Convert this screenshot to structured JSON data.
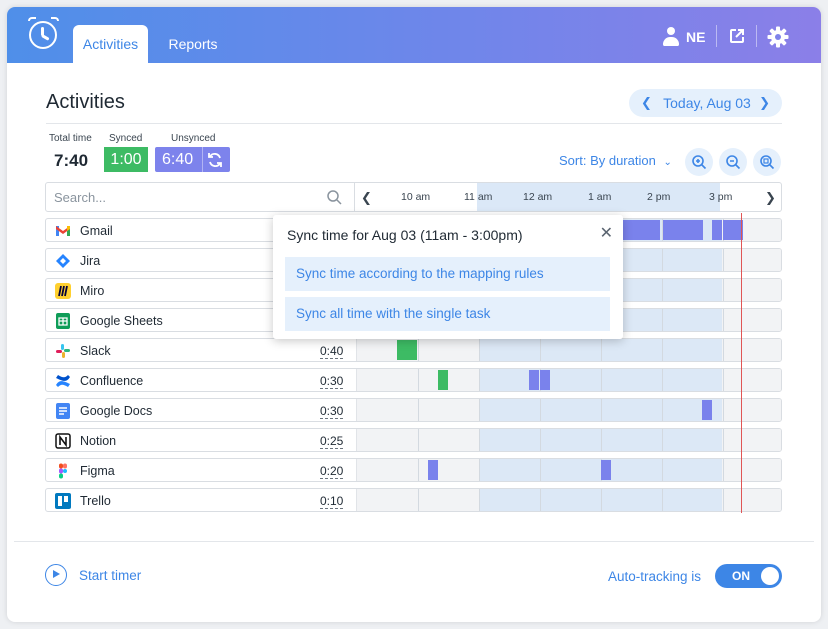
{
  "header": {
    "tabs": [
      {
        "label": "Activities",
        "active": true
      },
      {
        "label": "Reports",
        "active": false
      }
    ],
    "user_initials": "NE"
  },
  "page": {
    "title": "Activities",
    "date_label": "Today,  Aug 03"
  },
  "stats": {
    "total_label": "Total time",
    "total_value": "7:40",
    "synced_label": "Synced",
    "synced_value": "1:00",
    "unsynced_label": "Unsynced",
    "unsynced_value": "6:40"
  },
  "sort": {
    "label": "Sort: By duration"
  },
  "search": {
    "placeholder": "Search..."
  },
  "timeline": {
    "hours": [
      "10 am",
      "11 am",
      "12 am",
      "1 am",
      "2 pm",
      "3 pm"
    ]
  },
  "activities": [
    {
      "name": "Gmail",
      "duration": "",
      "icon": "gmail-icon"
    },
    {
      "name": "Jira",
      "duration": "",
      "icon": "jira-icon"
    },
    {
      "name": "Miro",
      "duration": "",
      "icon": "miro-icon"
    },
    {
      "name": "Google Sheets",
      "duration": "",
      "icon": "google-sheets-icon"
    },
    {
      "name": "Slack",
      "duration": "0:40",
      "icon": "slack-icon"
    },
    {
      "name": "Confluence",
      "duration": "0:30",
      "icon": "confluence-icon"
    },
    {
      "name": "Google Docs",
      "duration": "0:30",
      "icon": "google-docs-icon"
    },
    {
      "name": "Notion",
      "duration": "0:25",
      "icon": "notion-icon"
    },
    {
      "name": "Figma",
      "duration": "0:20",
      "icon": "figma-icon"
    },
    {
      "name": "Trello",
      "duration": "0:10",
      "icon": "trello-icon"
    }
  ],
  "popup": {
    "title_prefix": "Sync time for Aug 03",
    "title_range": "(11am - 3:00pm)",
    "option_mapping": "Sync time according to the mapping rules",
    "option_single": "Sync all time with the single task"
  },
  "footer": {
    "start_timer": "Start timer",
    "auto_tracking_label": "Auto-tracking is",
    "auto_tracking_state": "ON"
  },
  "colors": {
    "accent": "#3d86e6",
    "synced": "#3dbb64",
    "unsynced": "#7d83ec",
    "now_line": "#e05555"
  }
}
